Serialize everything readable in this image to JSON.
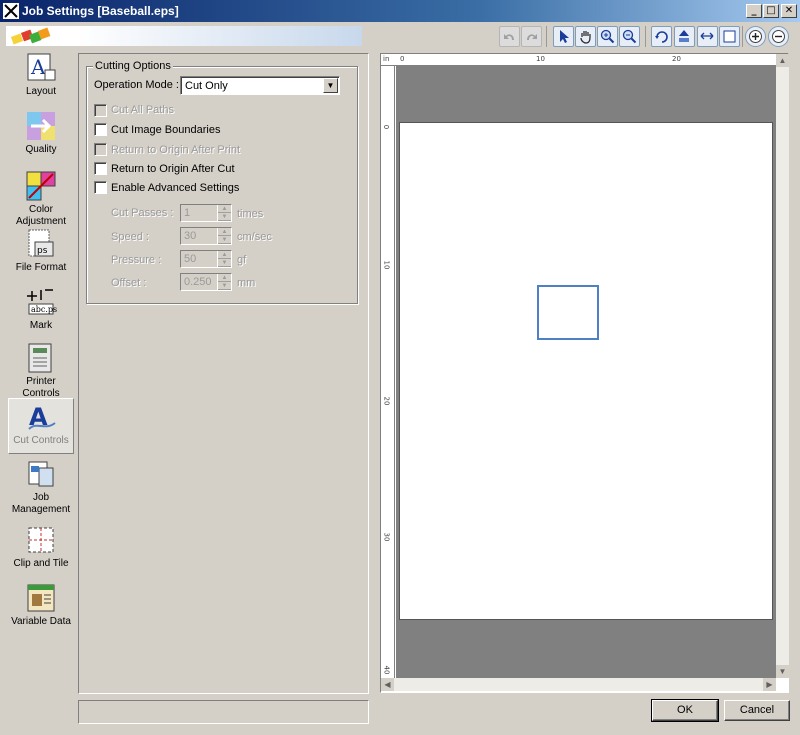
{
  "window": {
    "title": "Job Settings [Baseball.eps]",
    "minimize": "_",
    "maximize": "□",
    "close": "✕"
  },
  "toolbar": {
    "icons": [
      "undo-icon",
      "redo-icon",
      "pointer-icon",
      "hand-icon",
      "zoom-in-icon",
      "zoom-out-icon",
      "rotate-icon",
      "flip-icon",
      "fit-width-icon",
      "page-icon",
      "plus-icon",
      "minus-icon"
    ]
  },
  "sidebar": {
    "items": [
      {
        "label": "Layout",
        "icon": "layout-icon"
      },
      {
        "label": "Quality",
        "icon": "quality-icon"
      },
      {
        "label": "Color Adjustment",
        "icon": "color-adjustment-icon"
      },
      {
        "label": "File Format",
        "icon": "file-format-icon"
      },
      {
        "label": "Mark",
        "icon": "mark-icon"
      },
      {
        "label": "Printer Controls",
        "icon": "printer-controls-icon"
      },
      {
        "label": "Cut Controls",
        "icon": "cut-controls-icon"
      },
      {
        "label": "Job Management",
        "icon": "job-management-icon"
      },
      {
        "label": "Clip and Tile",
        "icon": "clip-tile-icon"
      },
      {
        "label": "Variable Data",
        "icon": "variable-data-icon"
      }
    ],
    "active": "Cut Controls"
  },
  "cutting_options": {
    "group_label": "Cutting Options",
    "operation_mode_label": "Operation Mode :",
    "operation_mode_value": "Cut Only",
    "checkboxes": {
      "cut_all_paths": "Cut All Paths",
      "cut_image_boundaries": "Cut Image Boundaries",
      "return_after_print": "Return to Origin After Print",
      "return_after_cut": "Return to Origin After Cut",
      "enable_advanced": "Enable Advanced Settings"
    },
    "cut_passes": {
      "label": "Cut Passes :",
      "value": "1",
      "unit": "times"
    },
    "speed": {
      "label": "Speed :",
      "value": "30",
      "unit": "cm/sec"
    },
    "pressure": {
      "label": "Pressure :",
      "value": "50",
      "unit": "gf"
    },
    "offset": {
      "label": "Offset :",
      "value": "0.250",
      "unit": "mm"
    }
  },
  "preview": {
    "ruler_unit": "in",
    "top_ticks": [
      "0",
      "10",
      "20"
    ],
    "left_ticks": [
      "0",
      "10",
      "20",
      "30",
      "40"
    ]
  },
  "buttons": {
    "ok": "OK",
    "cancel": "Cancel"
  },
  "colors": {
    "title_bar": "#0a246a",
    "cut_path": "#4f7fc4",
    "canvas_gray": "#808080"
  }
}
